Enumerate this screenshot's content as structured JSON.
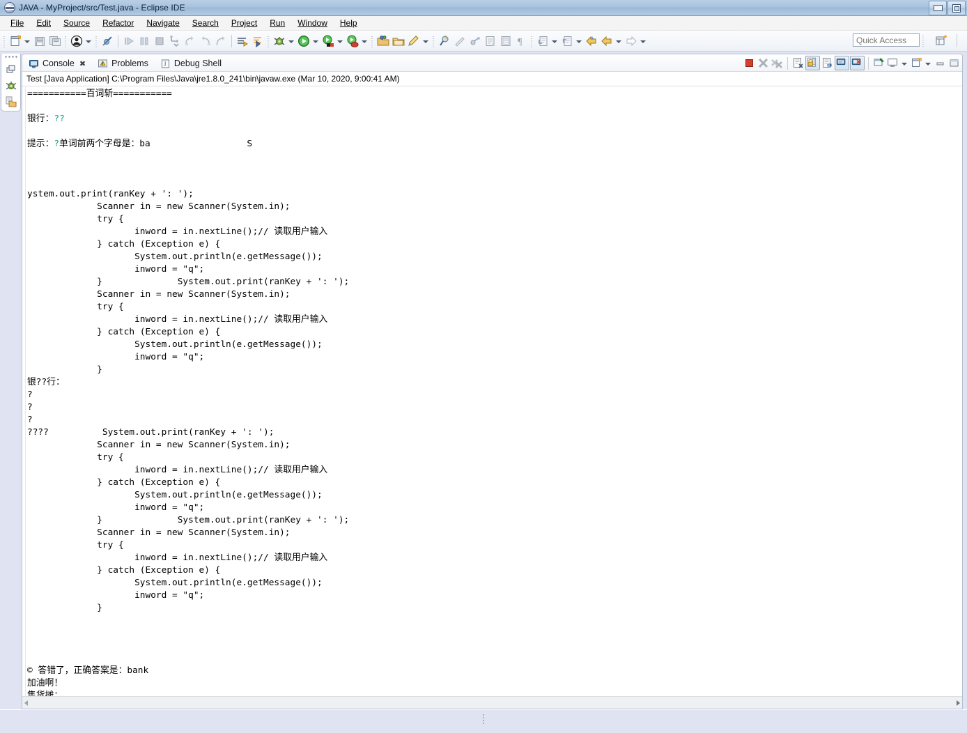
{
  "window": {
    "title": "JAVA - MyProject/src/Test.java - Eclipse IDE",
    "app_icon": "eclipse-icon",
    "buttons": {
      "minimize": "minimize-icon",
      "restore": "restore-icon"
    }
  },
  "menubar": {
    "items": [
      {
        "label": "File",
        "mnemonic_index": 0
      },
      {
        "label": "Edit",
        "mnemonic_index": 0
      },
      {
        "label": "Source",
        "mnemonic_index": 1
      },
      {
        "label": "Refactor",
        "mnemonic_index": 5
      },
      {
        "label": "Navigate",
        "mnemonic_index": 0
      },
      {
        "label": "Search",
        "mnemonic_index": 2
      },
      {
        "label": "Project",
        "mnemonic_index": 0
      },
      {
        "label": "Run",
        "mnemonic_index": 0
      },
      {
        "label": "Window",
        "mnemonic_index": 0
      },
      {
        "label": "Help",
        "mnemonic_index": 0
      }
    ]
  },
  "toolbar": {
    "quick_access_placeholder": "Quick Access",
    "groups": [
      {
        "items": [
          "new-wizard-icon",
          "new-dropdown-arrow",
          "save-icon",
          "save-all-icon"
        ]
      },
      {
        "items": [
          "person-icon",
          "person-dropdown-arrow"
        ]
      },
      {
        "items": [
          "skip-breakpoints-icon"
        ]
      },
      {
        "items": [
          "resume-icon",
          "suspend-icon",
          "terminate-icon",
          "step-into-icon",
          "step-over-icon",
          "step-return-icon",
          "drop-to-frame-icon"
        ]
      },
      {
        "items": [
          "next-annotation-icon",
          "previous-annotation-icon"
        ]
      },
      {
        "items": [
          "debug-icon",
          "debug-dropdown-arrow",
          "run-icon",
          "run-dropdown-arrow",
          "coverage-icon",
          "coverage-dropdown-arrow",
          "external-tools-icon",
          "external-tools-dropdown-arrow"
        ]
      },
      {
        "items": [
          "new-java-project-icon",
          "new-package-icon",
          "new-class-icon",
          "new-class-dropdown-arrow"
        ]
      },
      {
        "items": [
          "open-type-icon",
          "search-icon",
          "link-icon",
          "toggle-mark-occurrences-icon",
          "show-whitespace-icon",
          "pilcrow-icon"
        ]
      },
      {
        "items": [
          "previous-edit-icon",
          "previous-edit-dropdown-arrow",
          "next-edit-icon",
          "next-edit-dropdown-arrow",
          "back-icon",
          "back-dropdown-arrow",
          "forward-icon",
          "forward-dropdown-arrow"
        ]
      },
      {
        "items": [
          "open-perspective-icon"
        ]
      }
    ]
  },
  "fastview": {
    "items": [
      "restore-view-icon",
      "debug-perspective-icon",
      "package-explorer-icon"
    ]
  },
  "view": {
    "tabs": [
      {
        "label": "Console",
        "icon": "console-icon",
        "active": true,
        "closable": true,
        "close_glyph": "✖"
      },
      {
        "label": "Problems",
        "icon": "problems-icon",
        "active": false,
        "closable": false
      },
      {
        "label": "Debug Shell",
        "icon": "debug-shell-icon",
        "active": false,
        "closable": false
      }
    ],
    "toolbar_items": [
      "terminate-icon",
      "remove-launch-icon",
      "remove-all-terminated-icon",
      "clear-console-icon",
      "scroll-lock-icon",
      "word-wrap-icon",
      "show-console-on-output-icon",
      "show-console-on-error-icon",
      "pin-console-icon",
      "display-selected-console-icon",
      "display-selected-console-arrow",
      "open-console-icon",
      "open-console-arrow",
      "minimize-view-icon",
      "maximize-view-icon"
    ],
    "launch_line": "Test [Java Application] C:\\Program Files\\Java\\jre1.8.0_241\\bin\\javaw.exe (Mar 10, 2020, 9:00:41 AM)"
  },
  "console": {
    "accent_color": "#16a085",
    "lines": [
      {
        "text": "===========百词斩==========="
      },
      {
        "text": ""
      },
      {
        "segments": [
          {
            "text": "银行："
          },
          {
            "text": "??",
            "color": "green"
          }
        ]
      },
      {
        "text": ""
      },
      {
        "segments": [
          {
            "text": "提示："
          },
          {
            "text": "?",
            "color": "green"
          },
          {
            "text": "单词前两个字母是：ba                  S"
          }
        ]
      },
      {
        "text": ""
      },
      {
        "text": ""
      },
      {
        "text": ""
      },
      {
        "text": "ystem.out.print(ranKey + ': ');"
      },
      {
        "text": "             Scanner in = new Scanner(System.in);"
      },
      {
        "text": "             try {"
      },
      {
        "text": "                    inword = in.nextLine();// 读取用户输入"
      },
      {
        "text": "             } catch (Exception e) {"
      },
      {
        "text": "                    System.out.println(e.getMessage());"
      },
      {
        "text": "                    inword = \"q\";"
      },
      {
        "text": "             }              System.out.print(ranKey + ': ');"
      },
      {
        "text": "             Scanner in = new Scanner(System.in);"
      },
      {
        "text": "             try {"
      },
      {
        "text": "                    inword = in.nextLine();// 读取用户输入"
      },
      {
        "text": "             } catch (Exception e) {"
      },
      {
        "text": "                    System.out.println(e.getMessage());"
      },
      {
        "text": "                    inword = \"q\";"
      },
      {
        "text": "             }"
      },
      {
        "text": "银??行："
      },
      {
        "text": "?"
      },
      {
        "text": "?"
      },
      {
        "text": "?"
      },
      {
        "text": "????          System.out.print(ranKey + ': ');"
      },
      {
        "text": "             Scanner in = new Scanner(System.in);"
      },
      {
        "text": "             try {"
      },
      {
        "text": "                    inword = in.nextLine();// 读取用户输入"
      },
      {
        "text": "             } catch (Exception e) {"
      },
      {
        "text": "                    System.out.println(e.getMessage());"
      },
      {
        "text": "                    inword = \"q\";"
      },
      {
        "text": "             }              System.out.print(ranKey + ': ');"
      },
      {
        "text": "             Scanner in = new Scanner(System.in);"
      },
      {
        "text": "             try {"
      },
      {
        "text": "                    inword = in.nextLine();// 读取用户输入"
      },
      {
        "text": "             } catch (Exception e) {"
      },
      {
        "text": "                    System.out.println(e.getMessage());"
      },
      {
        "text": "                    inword = \"q\";"
      },
      {
        "text": "             }"
      },
      {
        "text": ""
      },
      {
        "text": ""
      },
      {
        "text": ""
      },
      {
        "text": ""
      },
      {
        "text": "© 答错了，正确答案是：bank"
      },
      {
        "text": "加油啊！"
      },
      {
        "text": "售货摊："
      }
    ]
  },
  "scrollbar": {
    "left_arrow": "scroll-left-arrow",
    "right_arrow": "scroll-right-arrow"
  }
}
